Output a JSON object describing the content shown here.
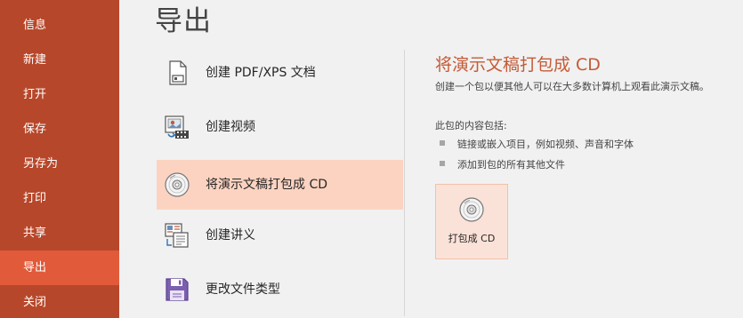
{
  "sidebar": {
    "items": [
      {
        "label": "信息"
      },
      {
        "label": "新建"
      },
      {
        "label": "打开"
      },
      {
        "label": "保存"
      },
      {
        "label": "另存为"
      },
      {
        "label": "打印"
      },
      {
        "label": "共享"
      },
      {
        "label": "导出",
        "active": true
      },
      {
        "label": "关闭"
      }
    ]
  },
  "main": {
    "title": "导出",
    "options": [
      {
        "label": "创建 PDF/XPS 文档",
        "icon": "pdf-document-icon"
      },
      {
        "label": "创建视频",
        "icon": "video-icon"
      },
      {
        "label": "将演示文稿打包成 CD",
        "icon": "cd-disc-icon",
        "active": true
      },
      {
        "label": "创建讲义",
        "icon": "handout-icon"
      },
      {
        "label": "更改文件类型",
        "icon": "save-disk-icon"
      }
    ]
  },
  "detail": {
    "title": "将演示文稿打包成 CD",
    "description": "创建一个包以便其他人可以在大多数计算机上观看此演示文稿。",
    "contents_heading": "此包的内容包括:",
    "bullets": [
      "链接或嵌入项目，例如视频、声音和字体",
      "添加到包的所有其他文件"
    ],
    "button_label": "打包成 CD"
  },
  "colors": {
    "sidebar_bg": "#b7472a",
    "sidebar_active": "#e15a3a",
    "accent_title": "#c55a37",
    "selected_option_bg": "#fcd3c1"
  }
}
